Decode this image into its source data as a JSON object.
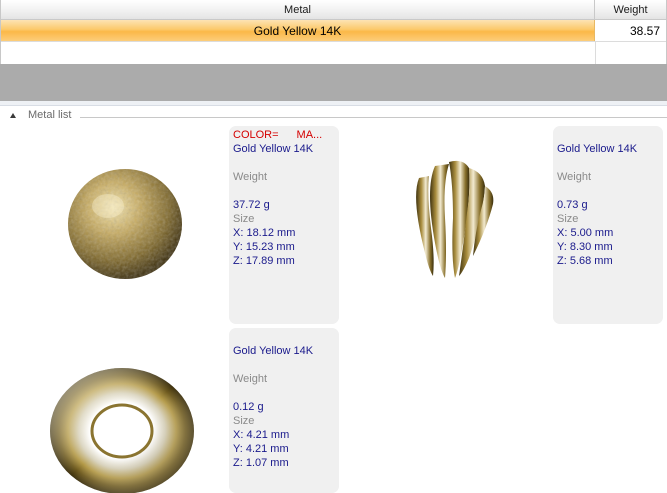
{
  "table": {
    "headers": {
      "metal": "Metal",
      "weight": "Weight"
    },
    "rows": [
      {
        "metal": "Gold Yellow 14K",
        "weight": "38.57"
      }
    ]
  },
  "metal_list": {
    "group_title": "Metal list",
    "items": [
      {
        "color_label": "COLOR=",
        "material_label": "MA...",
        "metal": "Gold Yellow 14K",
        "weight_label": "Weight",
        "weight": "37.72 g",
        "size_label": "Size",
        "x": "X: 18.12 mm",
        "y": "Y: 15.23 mm",
        "z": "Z: 17.89 mm",
        "icon": "textured-gold-sphere-icon"
      },
      {
        "metal": "Gold Yellow 14K",
        "weight_label": "Weight",
        "weight": "0.73 g",
        "size_label": "Size",
        "x": "X: 5.00 mm",
        "y": "Y: 8.30 mm",
        "z": "Z: 5.68 mm",
        "icon": "gold-prong-cluster-icon"
      },
      {
        "metal": "Gold Yellow 14K",
        "weight_label": "Weight",
        "weight": "0.12 g",
        "size_label": "Size",
        "x": "X: 4.21 mm",
        "y": "Y: 4.21 mm",
        "z": "Z: 1.07 mm",
        "icon": "gold-torus-ring-icon"
      }
    ]
  },
  "colors": {
    "selection_orange": "#fbb848",
    "gold": "#b59a3c",
    "label_blue": "#1a1a8c",
    "label_red": "#d40000"
  }
}
